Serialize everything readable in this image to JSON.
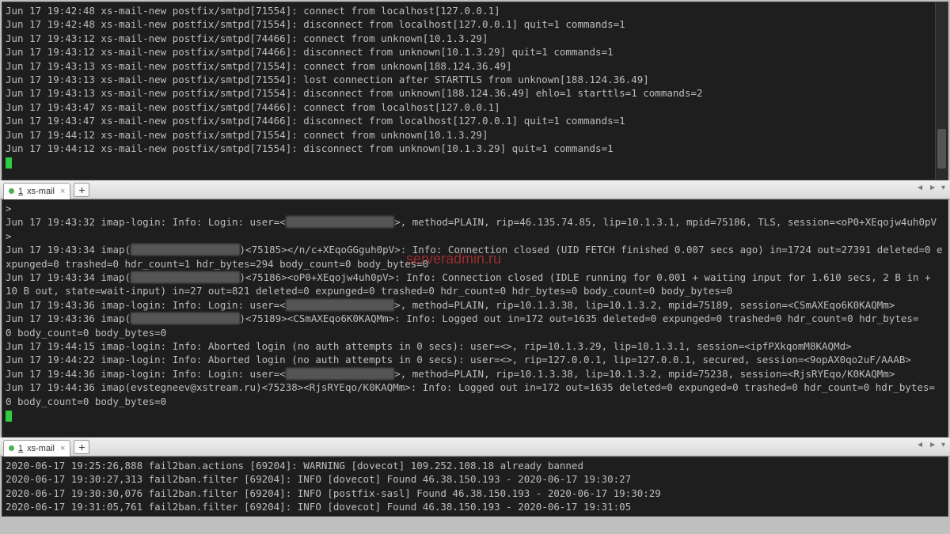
{
  "tabs": {
    "tab_num": "1",
    "tab_title": "xs-mail",
    "add_symbol": "+",
    "nav_left": "◄",
    "nav_right": "►",
    "nav_down": "▾"
  },
  "redacted": "xxxxxxxxxxxxxxxxxx",
  "watermark": "serveradmin.ru",
  "pane1": {
    "lines": [
      "Jun 17 19:42:48 xs-mail-new postfix/smtpd[71554]: connect from localhost[127.0.0.1]",
      "Jun 17 19:42:48 xs-mail-new postfix/smtpd[71554]: disconnect from localhost[127.0.0.1] quit=1 commands=1",
      "Jun 17 19:43:12 xs-mail-new postfix/smtpd[74466]: connect from unknown[10.1.3.29]",
      "Jun 17 19:43:12 xs-mail-new postfix/smtpd[74466]: disconnect from unknown[10.1.3.29] quit=1 commands=1",
      "Jun 17 19:43:13 xs-mail-new postfix/smtpd[71554]: connect from unknown[188.124.36.49]",
      "Jun 17 19:43:13 xs-mail-new postfix/smtpd[71554]: lost connection after STARTTLS from unknown[188.124.36.49]",
      "Jun 17 19:43:13 xs-mail-new postfix/smtpd[71554]: disconnect from unknown[188.124.36.49] ehlo=1 starttls=1 commands=2",
      "Jun 17 19:43:47 xs-mail-new postfix/smtpd[74466]: connect from localhost[127.0.0.1]",
      "Jun 17 19:43:47 xs-mail-new postfix/smtpd[74466]: disconnect from localhost[127.0.0.1] quit=1 commands=1",
      "Jun 17 19:44:12 xs-mail-new postfix/smtpd[71554]: connect from unknown[10.1.3.29]",
      "Jun 17 19:44:12 xs-mail-new postfix/smtpd[71554]: disconnect from unknown[10.1.3.29] quit=1 commands=1"
    ]
  },
  "pane2": {
    "prompt": ">",
    "l1a": "Jun 17 19:43:32 imap-login: Info: Login: user=<",
    "l1b": ">, method=PLAIN, rip=46.135.74.85, lip=10.1.3.1, mpid=75186, TLS, session=<oP0+XEqojw4uh0pV",
    "l2a": "Jun 17 19:43:34 imap(",
    "l2b": ")<75185></n/c+XEqoGGguh0pV>: Info: Connection closed (UID FETCH finished 0.007 secs ago) in=1724 out=27391 deleted=0 e",
    "l2c": "xpunged=0 trashed=0 hdr_count=1 hdr_bytes=294 body_count=0 body_bytes=0",
    "l3a": "Jun 17 19:43:34 imap(",
    "l3b": ")<75186><oP0+XEqojw4uh0pV>: Info: Connection closed (IDLE running for 0.001 + waiting input for 1.610 secs, 2 B in +",
    "l3c": "10 B out, state=wait-input) in=27 out=821 deleted=0 expunged=0 trashed=0 hdr_count=0 hdr_bytes=0 body_count=0 body_bytes=0",
    "l4a": "Jun 17 19:43:36 imap-login: Info: Login: user=<",
    "l4b": ">, method=PLAIN, rip=10.1.3.38, lip=10.1.3.2, mpid=75189, session=<CSmAXEqo6K0KAQMm>",
    "l5a": "Jun 17 19:43:36 imap(",
    "l5b": ")<75189><CSmAXEqo6K0KAQMm>: Info: Logged out in=172 out=1635 deleted=0 expunged=0 trashed=0 hdr_count=0 hdr_bytes=",
    "l5c": "0 body_count=0 body_bytes=0",
    "l6": "Jun 17 19:44:15 imap-login: Info: Aborted login (no auth attempts in 0 secs): user=<>, rip=10.1.3.29, lip=10.1.3.1, session=<ipfPXkqomM8KAQMd>",
    "l7": "Jun 17 19:44:22 imap-login: Info: Aborted login (no auth attempts in 0 secs): user=<>, rip=127.0.0.1, lip=127.0.0.1, secured, session=<9opAX0qo2uF/AAAB>",
    "l8a": "Jun 17 19:44:36 imap-login: Info: Login: user=<",
    "l8b": ">, method=PLAIN, rip=10.1.3.38, lip=10.1.3.2, mpid=75238, session=<RjsRYEqo/K0KAQMm>",
    "l9": "Jun 17 19:44:36 imap(evstegneev@xstream.ru)<75238><RjsRYEqo/K0KAQMm>: Info: Logged out in=172 out=1635 deleted=0 expunged=0 trashed=0 hdr_count=0 hdr_bytes=",
    "l9b": "0 body_count=0 body_bytes=0"
  },
  "pane3": {
    "lines": [
      "2020-06-17 19:25:26,888 fail2ban.actions        [69204]: WARNING [dovecot] 109.252.108.18 already banned",
      "2020-06-17 19:30:27,313 fail2ban.filter         [69204]: INFO    [dovecot] Found 46.38.150.193 - 2020-06-17 19:30:27",
      "2020-06-17 19:30:30,076 fail2ban.filter         [69204]: INFO    [postfix-sasl] Found 46.38.150.193 - 2020-06-17 19:30:29",
      "2020-06-17 19:31:05,761 fail2ban.filter         [69204]: INFO    [dovecot] Found 46.38.150.193 - 2020-06-17 19:31:05"
    ]
  }
}
